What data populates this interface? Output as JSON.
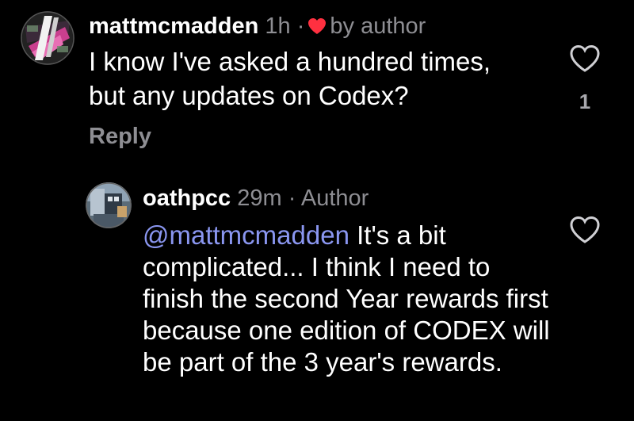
{
  "comments": [
    {
      "username": "mattmcmadden",
      "time": "1h",
      "separator": "·",
      "liked_by": "by author",
      "text": "I know I've asked a hundred times,\nbut any updates on Codex?",
      "reply_label": "Reply",
      "like_icon": "heart-outline-icon",
      "like_count": "1",
      "avatar_icon": "avatar-image"
    },
    {
      "username": "oathpcc",
      "time": "29m",
      "separator": "·",
      "badge": "Author",
      "mention": "@mattmcmadden",
      "text": " It's a bit complicated... I think I need to finish the second Year rewards first because one edition of CODEX will be part of the 3 year's rewards.",
      "like_icon": "heart-outline-icon",
      "avatar_icon": "avatar-image"
    }
  ],
  "colors": {
    "background": "#000000",
    "text": "#ffffff",
    "meta": "#8e8e93",
    "mention": "#8a96f0",
    "heart_red": "#ff3040"
  }
}
